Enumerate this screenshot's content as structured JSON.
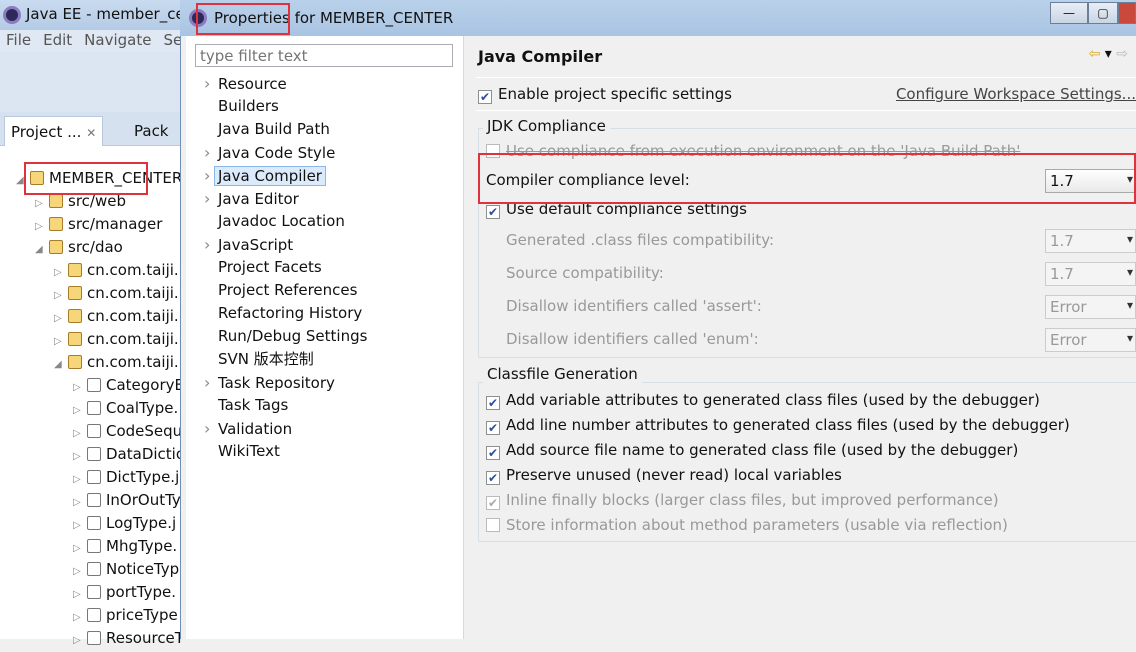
{
  "background_window": {
    "title": "Java EE - member_center",
    "menu": [
      "File",
      "Edit",
      "Navigate",
      "Se"
    ],
    "tabs": [
      "Project ...",
      "Pack"
    ],
    "tree": [
      {
        "label": "MEMBER_CENTER",
        "level": 0,
        "expanded": true
      },
      {
        "label": "src/web",
        "level": 1
      },
      {
        "label": "src/manager",
        "level": 1
      },
      {
        "label": "src/dao",
        "level": 1,
        "expanded": true
      },
      {
        "label": "cn.com.taiji.r",
        "level": 2
      },
      {
        "label": "cn.com.taiji.r",
        "level": 2
      },
      {
        "label": "cn.com.taiji.r",
        "level": 2
      },
      {
        "label": "cn.com.taiji.r",
        "level": 2
      },
      {
        "label": "cn.com.taiji.r",
        "level": 2,
        "expanded": true
      },
      {
        "label": "CategoryE",
        "level": 3
      },
      {
        "label": "CoalType.",
        "level": 3
      },
      {
        "label": "CodeSequ",
        "level": 3
      },
      {
        "label": "DataDictio",
        "level": 3
      },
      {
        "label": "DictType.j",
        "level": 3
      },
      {
        "label": "InOrOutTy",
        "level": 3
      },
      {
        "label": "LogType.j",
        "level": 3
      },
      {
        "label": "MhgType.",
        "level": 3
      },
      {
        "label": "NoticeTyp",
        "level": 3
      },
      {
        "label": "portType.",
        "level": 3
      },
      {
        "label": "priceType",
        "level": 3
      },
      {
        "label": "ResourceT",
        "level": 3
      }
    ]
  },
  "dialog": {
    "title": "Properties for MEMBER_CENTER",
    "filter_placeholder": "type filter text",
    "nav": [
      {
        "label": "Resource",
        "arrow": true
      },
      {
        "label": "Builders"
      },
      {
        "label": "Java Build Path"
      },
      {
        "label": "Java Code Style",
        "arrow": true
      },
      {
        "label": "Java Compiler",
        "arrow": true,
        "selected": true
      },
      {
        "label": "Java Editor",
        "arrow": true
      },
      {
        "label": "Javadoc Location"
      },
      {
        "label": "JavaScript",
        "arrow": true
      },
      {
        "label": "Project Facets"
      },
      {
        "label": "Project References"
      },
      {
        "label": "Refactoring History"
      },
      {
        "label": "Run/Debug Settings"
      },
      {
        "label": "SVN 版本控制"
      },
      {
        "label": "Task Repository",
        "arrow": true
      },
      {
        "label": "Task Tags"
      },
      {
        "label": "Validation",
        "arrow": true
      },
      {
        "label": "WikiText"
      }
    ],
    "page": {
      "title": "Java Compiler",
      "enable_label": "Enable project specific settings",
      "enable_checked": true,
      "configure_link": "Configure Workspace Settings...",
      "jdk_group": "JDK Compliance",
      "use_env_label": "Use compliance from execution environment on the 'Java Build Path'",
      "use_env_checked": false,
      "compliance_label": "Compiler compliance level:",
      "compliance_value": "1.7",
      "use_default_label": "Use default compliance settings",
      "use_default_checked": true,
      "settings": [
        {
          "label": "Generated .class files compatibility:",
          "value": "1.7"
        },
        {
          "label": "Source compatibility:",
          "value": "1.7"
        },
        {
          "label": "Disallow identifiers called 'assert':",
          "value": "Error"
        },
        {
          "label": "Disallow identifiers called 'enum':",
          "value": "Error"
        }
      ],
      "classfile_group": "Classfile Generation",
      "classfile": [
        {
          "label": "Add variable attributes to generated class files (used by the debugger)",
          "checked": true
        },
        {
          "label": "Add line number attributes to generated class files (used by the debugger)",
          "checked": true
        },
        {
          "label": "Add source file name to generated class file (used by the debugger)",
          "checked": true
        },
        {
          "label": "Preserve unused (never read) local variables",
          "checked": true
        },
        {
          "label": "Inline finally blocks (larger class files, but improved performance)",
          "checked": true,
          "disabled": true
        },
        {
          "label": "Store information about method parameters (usable via reflection)",
          "checked": false,
          "disabled": true
        }
      ]
    }
  },
  "highlight_color": "#e0323c"
}
